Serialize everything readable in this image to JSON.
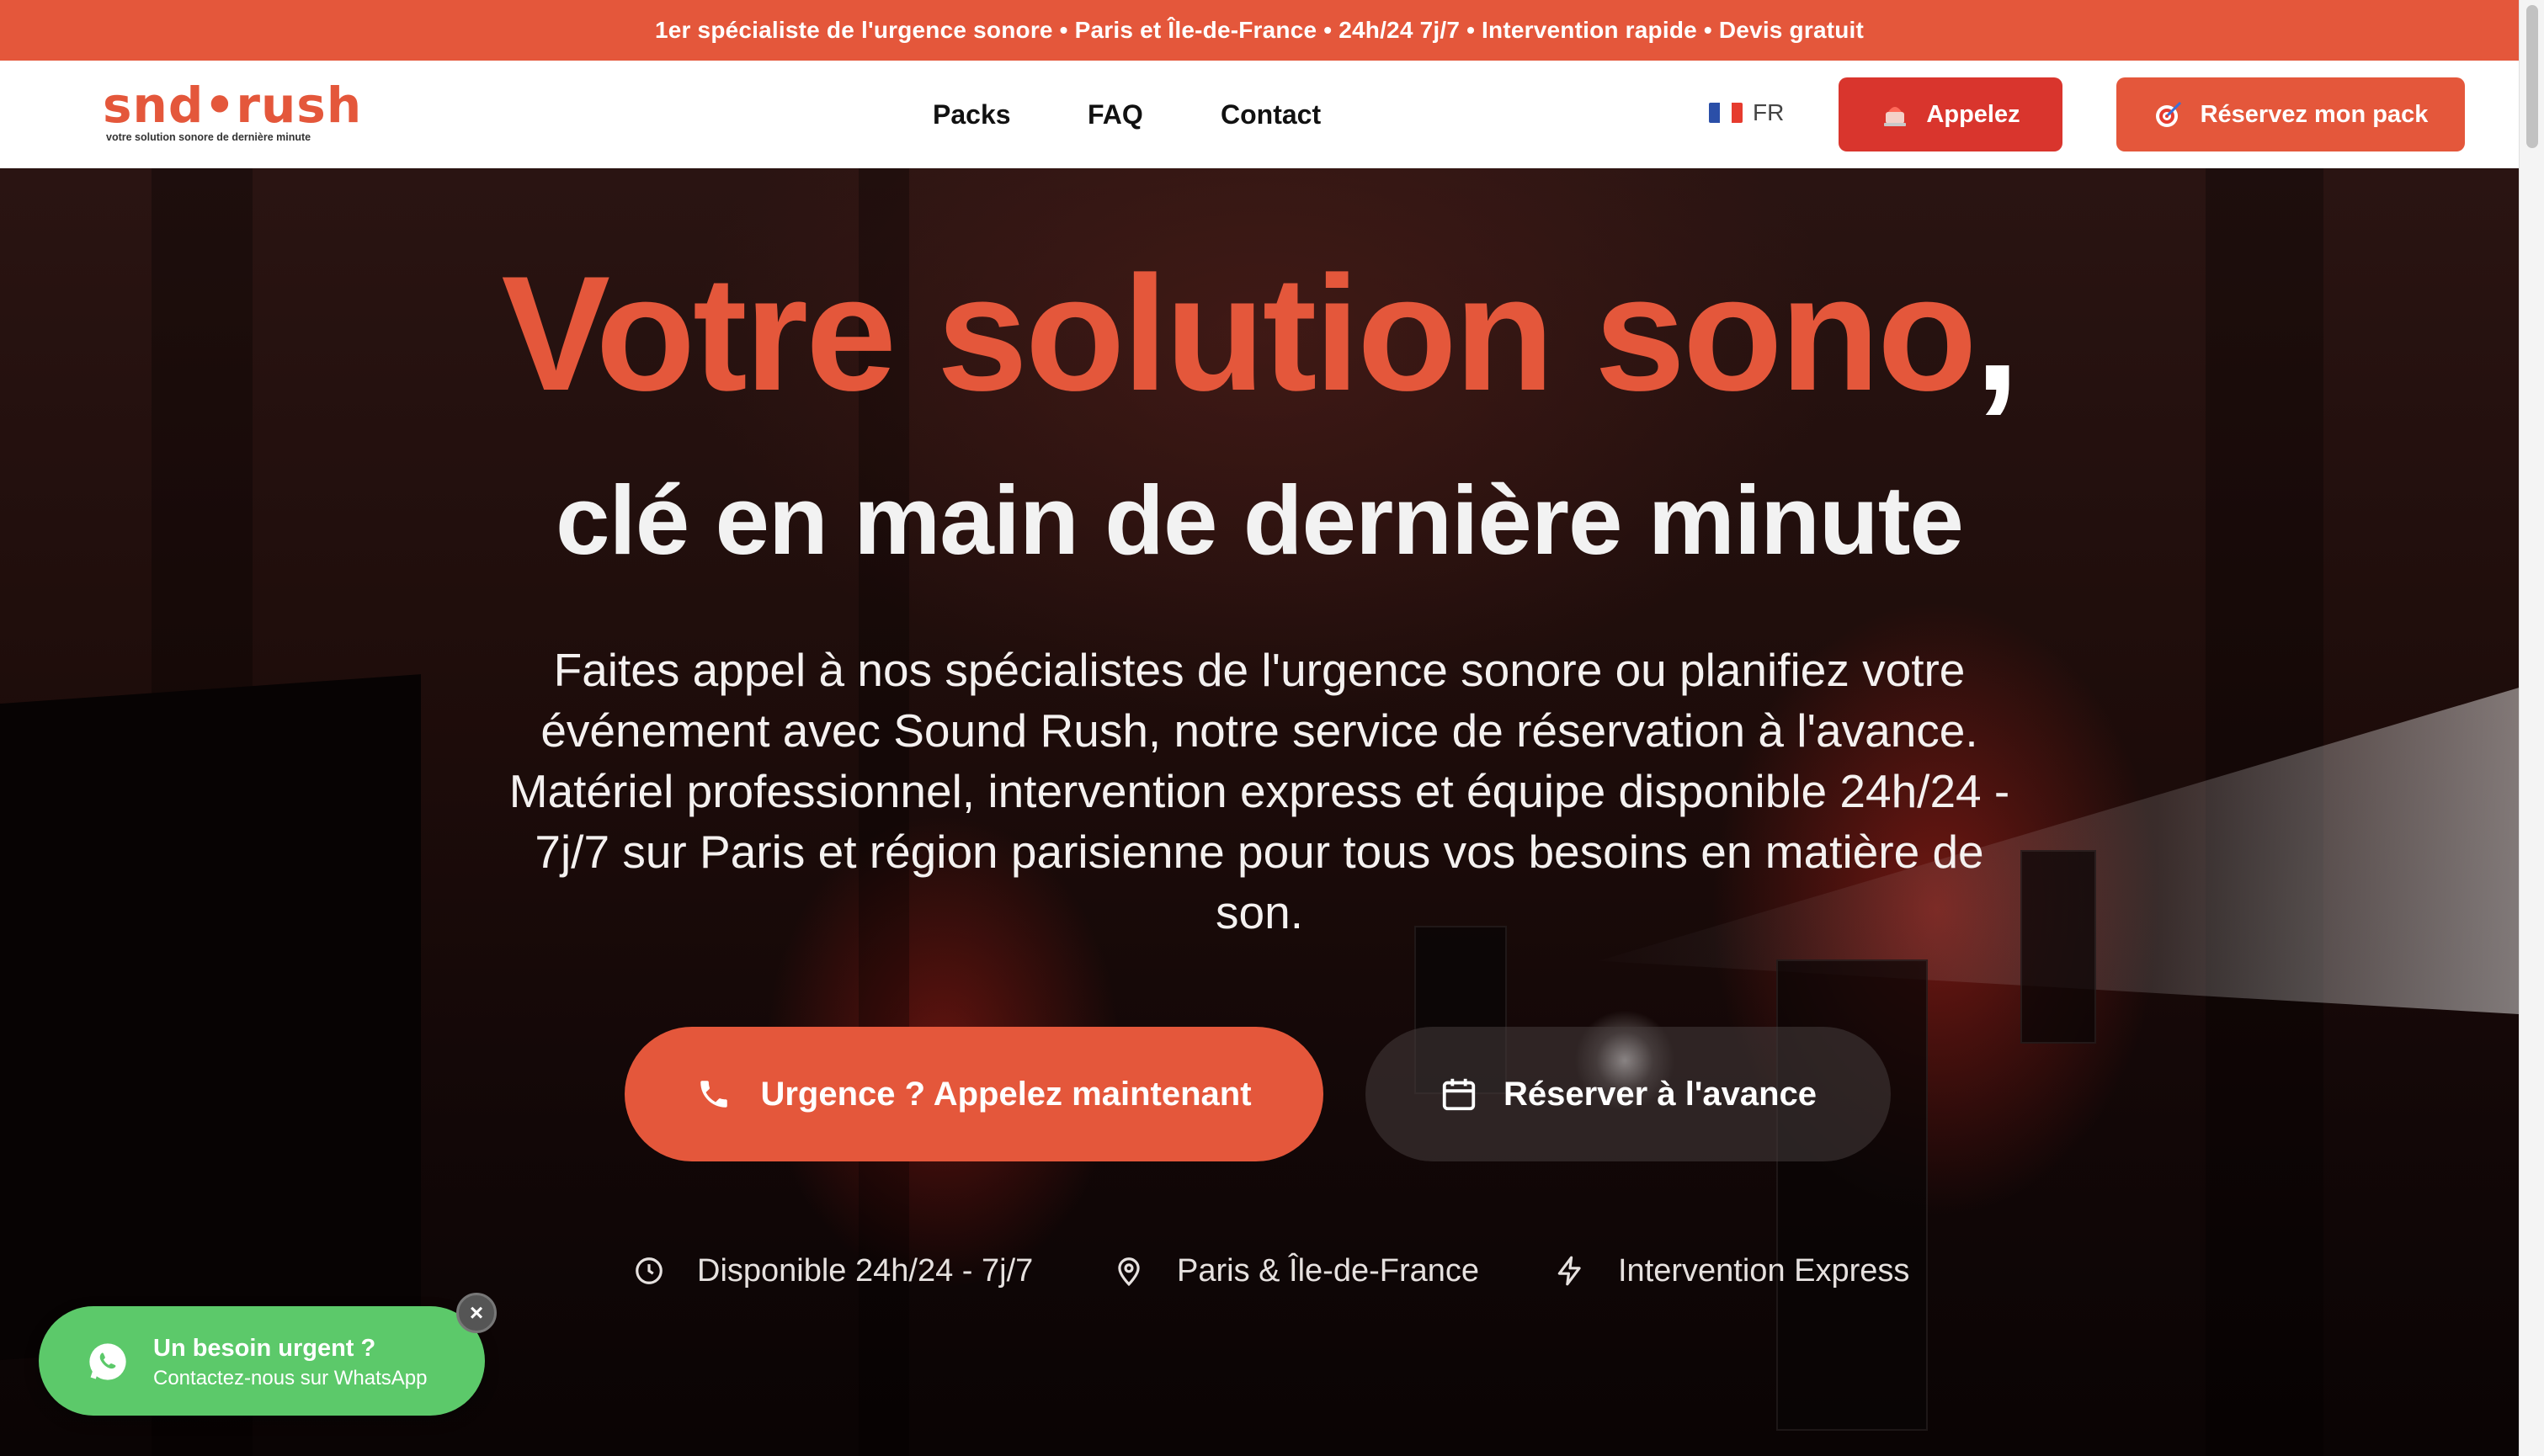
{
  "topbar": {
    "text": "1er spécialiste de l'urgence sonore • Paris et Île-de-France • 24h/24 7j/7 • Intervention rapide • Devis gratuit"
  },
  "header": {
    "logo_word": "snd•rush",
    "logo_tagline": "votre solution sonore de dernière minute",
    "nav": [
      {
        "label": "Packs"
      },
      {
        "label": "FAQ"
      },
      {
        "label": "Contact"
      }
    ],
    "language": "FR",
    "call_label": "Appelez",
    "book_label": "Réservez mon pack"
  },
  "hero": {
    "title_main": "Votre solution sono",
    "title_comma": ",",
    "subtitle": "clé en main de dernière minute",
    "lead": "Faites appel à nos spécialistes de l'urgence sonore ou planifiez votre événement avec Sound Rush, notre service de réservation à l'avance. Matériel professionnel, intervention express et équipe disponible 24h/24 - 7j/7 sur Paris et région parisienne pour tous vos besoins en matière de son.",
    "cta_urgent": "Urgence ? Appelez maintenant",
    "cta_book": "Réserver à l'avance",
    "features": [
      {
        "icon": "clock-icon",
        "label": "Disponible 24h/24 - 7j/7"
      },
      {
        "icon": "map-pin-icon",
        "label": "Paris & Île-de-France"
      },
      {
        "icon": "lightning-icon",
        "label": "Intervention Express"
      }
    ]
  },
  "whatsapp": {
    "title": "Un besoin urgent ?",
    "subtitle": "Contactez-nous sur WhatsApp",
    "close": "×"
  },
  "colors": {
    "brand": "#e4573b",
    "call_button": "#d9352d",
    "whatsapp": "#5cc96a"
  }
}
